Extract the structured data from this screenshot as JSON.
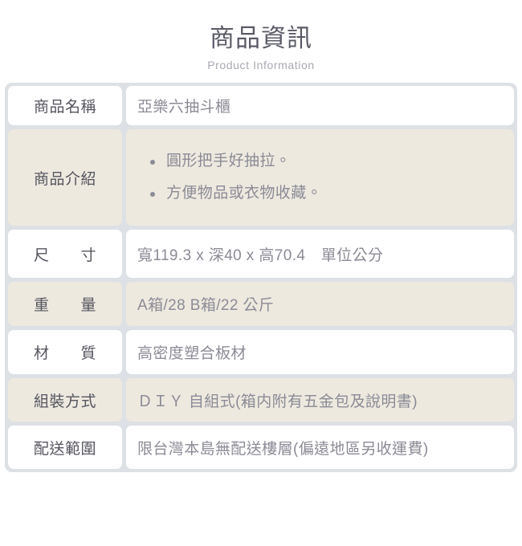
{
  "heading": {
    "title": "商品資訊",
    "subtitle": "Product Information"
  },
  "colors": {
    "table_background": "#dde0e4",
    "cell_white": "#ffffff",
    "cell_beige": "#ede9df",
    "label_text": "#55555f",
    "value_text": "#8b8b96",
    "page_background": "#ffffff"
  },
  "spec_table": {
    "rows": [
      {
        "label": "商品名稱",
        "value": "亞樂六抽斗櫃",
        "shade": "white"
      },
      {
        "label": "商品介紹",
        "bullets": [
          "圓形把手好抽拉。",
          "方便物品或衣物收藏。"
        ],
        "shade": "beige"
      },
      {
        "label": "尺　　寸",
        "value": "寬119.3 x 深40 x 高70.4　單位公分",
        "shade": "white"
      },
      {
        "label": "重　　量",
        "value": "A箱/28 B箱/22 公斤",
        "shade": "beige"
      },
      {
        "label": "材　　質",
        "value": "高密度塑合板材",
        "shade": "white"
      },
      {
        "label": "組裝方式",
        "value": "ＤＩＹ 自組式(箱内附有五金包及說明書)",
        "shade": "beige"
      },
      {
        "label": "配送範圍",
        "value": "限台灣本島無配送樓層(偏遠地區另收運費)",
        "shade": "white"
      }
    ]
  }
}
